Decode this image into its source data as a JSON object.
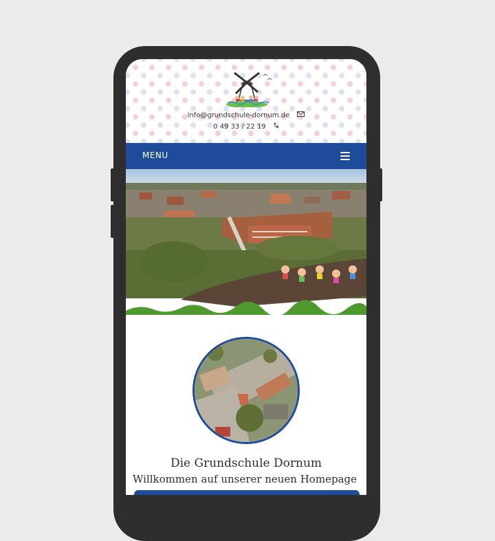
{
  "header": {
    "email": "info@grundschule-dornum.de",
    "email_icon": "envelope-icon",
    "phone": "0 49 33 / 22 19",
    "phone_icon": "phone-icon",
    "logo_icon": "windmill-children-logo"
  },
  "nav": {
    "menu_label": "MENU",
    "menu_icon": "hamburger-icon"
  },
  "main": {
    "title": "Die Grundschule Dornum",
    "subtitle": "Willkommen auf unserer neuen Homepage"
  },
  "colors": {
    "nav_blue": "#1f4c9a",
    "background": "#ebebeb",
    "phone_frame": "#2e2e2e"
  }
}
